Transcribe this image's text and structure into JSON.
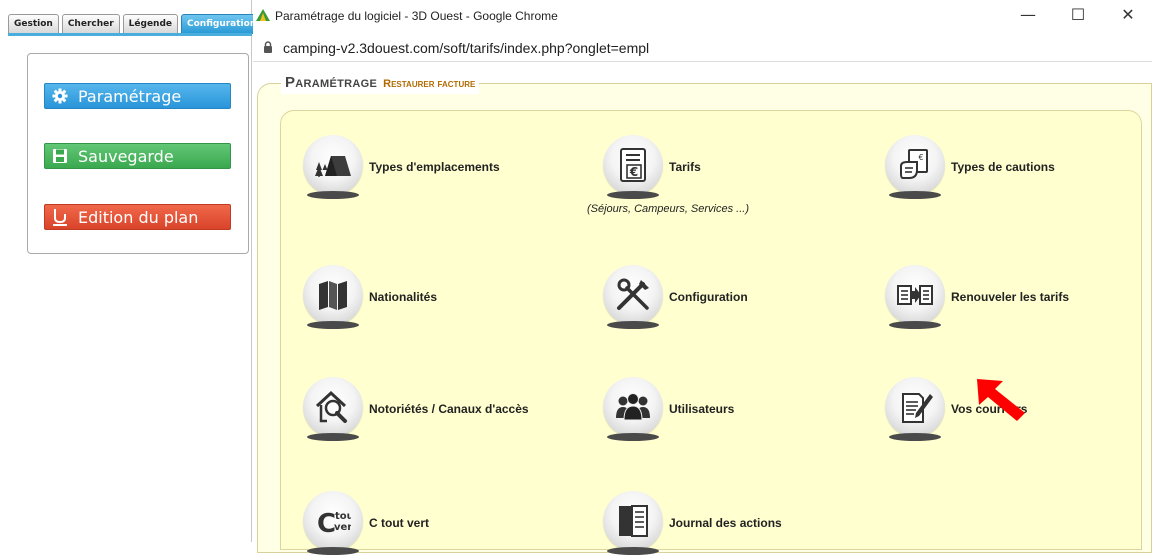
{
  "left_app": {
    "tabs": [
      "Gestion",
      "Chercher",
      "Légende",
      "Configuration"
    ],
    "active_tab": "Configuration",
    "buttons": {
      "parametrage": "Paramétrage",
      "sauvegarde": "Sauvegarde",
      "edition_plan": "Edition du plan"
    }
  },
  "browser": {
    "window_title": "Paramétrage du logiciel - 3D Ouest - Google Chrome",
    "url": "camping-v2.3douest.com/soft/tarifs/index.php?onglet=empl",
    "controls": {
      "minimize": "—",
      "maximize": "☐",
      "close": "✕"
    }
  },
  "page": {
    "legend_title": "Paramétrage",
    "legend_subtitle": "Restaurer facture",
    "items": [
      {
        "label": "Types d'emplacements",
        "icon": "tent-icon"
      },
      {
        "label": "Tarifs",
        "sublabel": "(Séjours, Campeurs, Services ...)",
        "icon": "tariff-icon"
      },
      {
        "label": "Types de cautions",
        "icon": "deposit-icon"
      },
      {
        "label": "Nationalités",
        "icon": "map-icon"
      },
      {
        "label": "Configuration",
        "icon": "tools-icon"
      },
      {
        "label": "Renouveler les tarifs",
        "icon": "renew-icon"
      },
      {
        "label": "Notoriétés / Canaux d'accès",
        "icon": "house-search-icon"
      },
      {
        "label": "Utilisateurs",
        "icon": "users-icon"
      },
      {
        "label": "Vos courriers",
        "icon": "letter-icon"
      },
      {
        "label": "C tout vert",
        "icon": "ctoutvert-icon",
        "logo_text": [
          "C",
          "tout",
          "vert"
        ]
      },
      {
        "label": "Journal des actions",
        "icon": "journal-icon"
      }
    ]
  },
  "colors": {
    "accent_blue": "#2995d9",
    "accent_green": "#3aa84f",
    "accent_red": "#d9442a",
    "panel_yellow": "#ffffd0",
    "arrow_red": "#ff0000"
  }
}
